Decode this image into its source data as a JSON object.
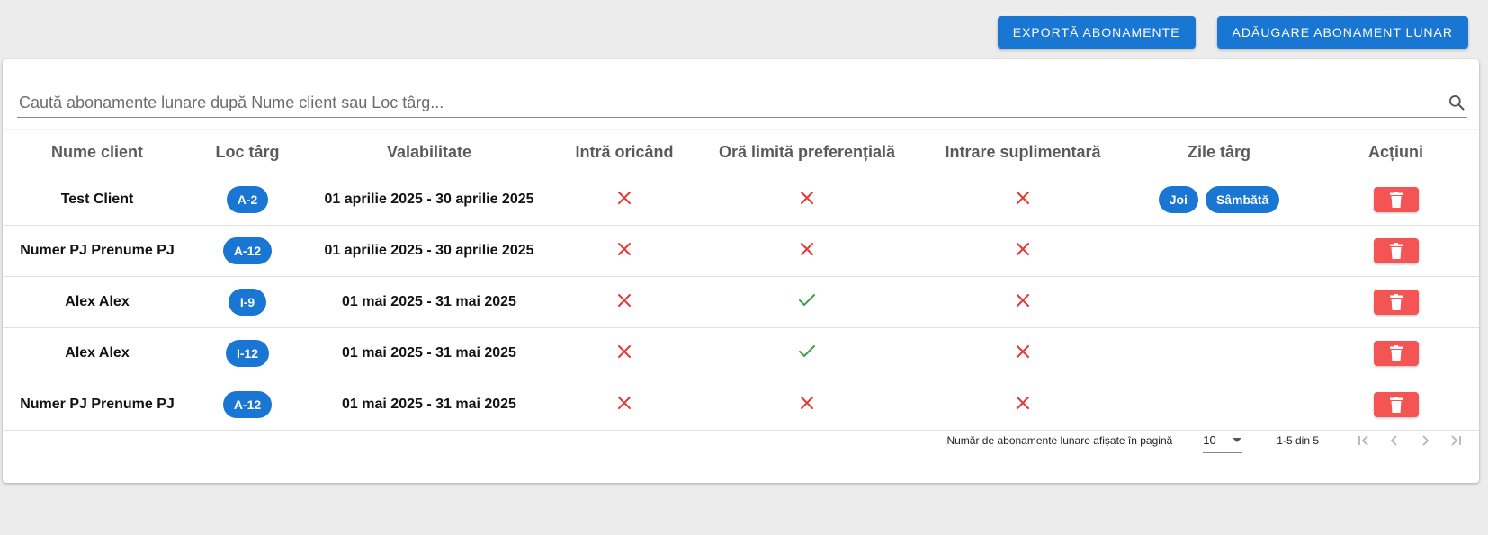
{
  "actions": {
    "export_label": "EXPORTĂ ABONAMENTE",
    "add_label": "ADĂUGARE ABONAMENT LUNAR"
  },
  "search": {
    "placeholder": "Caută abonamente lunare după Nume client sau Loc târg..."
  },
  "table": {
    "headers": [
      "Nume client",
      "Loc târg",
      "Valabilitate",
      "Intră oricând",
      "Oră limită preferențială",
      "Intrare suplimentară",
      "Zile târg",
      "Acțiuni"
    ],
    "rows": [
      {
        "client": "Test Client",
        "loc": "A-2",
        "validity": "01 aprilie 2025 - 30 aprilie 2025",
        "anytime": false,
        "pref_hour": false,
        "extra": false,
        "days": [
          "Joi",
          "Sâmbătă"
        ]
      },
      {
        "client": "Numer PJ Prenume PJ",
        "loc": "A-12",
        "validity": "01 aprilie 2025 - 30 aprilie 2025",
        "anytime": false,
        "pref_hour": false,
        "extra": false,
        "days": []
      },
      {
        "client": "Alex Alex",
        "loc": "I-9",
        "validity": "01 mai 2025 - 31 mai 2025",
        "anytime": false,
        "pref_hour": true,
        "extra": false,
        "days": []
      },
      {
        "client": "Alex Alex",
        "loc": "I-12",
        "validity": "01 mai 2025 - 31 mai 2025",
        "anytime": false,
        "pref_hour": true,
        "extra": false,
        "days": []
      },
      {
        "client": "Numer PJ Prenume PJ",
        "loc": "A-12",
        "validity": "01 mai 2025 - 31 mai 2025",
        "anytime": false,
        "pref_hour": false,
        "extra": false,
        "days": []
      }
    ]
  },
  "pagination": {
    "rows_label": "Număr de abonamente lunare afișate în pagină",
    "rows_per_page": "10",
    "range": "1-5 din 5"
  },
  "colors": {
    "primary": "#1976d2",
    "danger": "#f45454",
    "cross": "#e53935",
    "check": "#43a047"
  }
}
